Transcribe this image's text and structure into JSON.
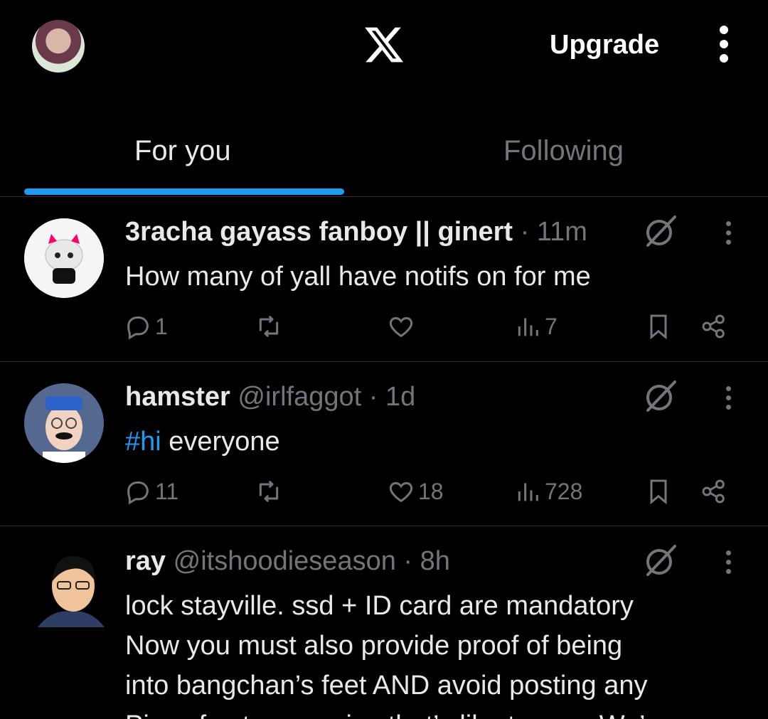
{
  "topbar": {
    "upgrade_label": "Upgrade"
  },
  "tabs": [
    {
      "label": "For you",
      "active": true
    },
    {
      "label": "Following",
      "active": false
    }
  ],
  "colors": {
    "accent": "#1d9bf0",
    "background": "#000000",
    "muted": "#71767b"
  },
  "posts": [
    {
      "name": "3racha gayass fanboy || ginert",
      "handle": "",
      "time_sep": " · ",
      "time": "11m",
      "text": "How many of yall have notifs on for me",
      "replies": "1",
      "retweets": "",
      "likes": "",
      "views": "7"
    },
    {
      "name": "hamster",
      "handle": "@irlfaggot",
      "time_sep": " · ",
      "time": "1d",
      "hashtag": "#hi",
      "text": " everyone",
      "replies": "11",
      "retweets": "",
      "likes": "18",
      "views": "728"
    },
    {
      "name": "ray",
      "handle": "@itshoodieseason",
      "time_sep": " · ",
      "time": "8h",
      "lines": [
        "lock stayville. ssd + ID card are mandatory",
        "Now you must also provide proof of being",
        "into bangchan’s feet AND avoid posting any",
        "Pics of cutes puppies that’s like trauma We’re"
      ]
    }
  ]
}
